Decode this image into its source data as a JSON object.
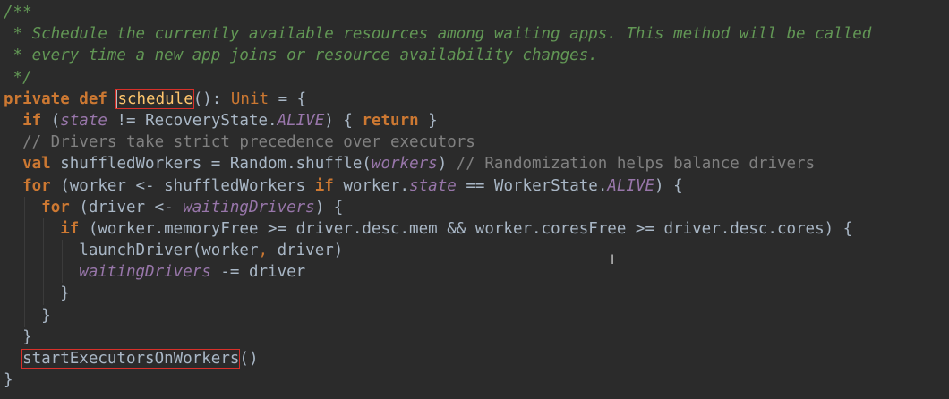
{
  "editor": {
    "lines": [
      {
        "segments": [
          {
            "c": "doc",
            "t": "/**"
          }
        ]
      },
      {
        "segments": [
          {
            "c": "doc",
            "t": " * Schedule the currently available resources among waiting apps. This method will be called"
          }
        ]
      },
      {
        "segments": [
          {
            "c": "doc",
            "t": " * every time a new app joins or resource availability changes."
          }
        ]
      },
      {
        "segments": [
          {
            "c": "doc",
            "t": " */"
          }
        ]
      },
      {
        "segments": [
          {
            "c": "kw",
            "t": "private def "
          },
          {
            "c": "fn-decl boxed caret-box",
            "t": "schedule"
          },
          {
            "c": "plain",
            "t": "(): "
          },
          {
            "c": "type",
            "t": "Unit"
          },
          {
            "c": "plain",
            "t": " = {"
          }
        ]
      },
      {
        "indent": 1,
        "segments": [
          {
            "c": "kw",
            "t": "if "
          },
          {
            "c": "plain",
            "t": "("
          },
          {
            "c": "field",
            "t": "state"
          },
          {
            "c": "plain",
            "t": " != RecoveryState."
          },
          {
            "c": "const",
            "t": "ALIVE"
          },
          {
            "c": "plain",
            "t": ") { "
          },
          {
            "c": "kw",
            "t": "return"
          },
          {
            "c": "plain",
            "t": " }"
          }
        ]
      },
      {
        "indent": 1,
        "segments": [
          {
            "c": "comment",
            "t": "// Drivers take strict precedence over executors"
          }
        ]
      },
      {
        "indent": 1,
        "segments": [
          {
            "c": "kw",
            "t": "val "
          },
          {
            "c": "plain",
            "t": "shuffledWorkers = Random.shuffle("
          },
          {
            "c": "field",
            "t": "workers"
          },
          {
            "c": "plain",
            "t": ") "
          },
          {
            "c": "comment",
            "t": "// Randomization helps balance drivers"
          }
        ]
      },
      {
        "indent": 1,
        "segments": [
          {
            "c": "kw",
            "t": "for "
          },
          {
            "c": "plain",
            "t": "(worker <- shuffledWorkers "
          },
          {
            "c": "kw",
            "t": "if "
          },
          {
            "c": "plain",
            "t": "worker."
          },
          {
            "c": "field",
            "t": "state"
          },
          {
            "c": "plain",
            "t": " == WorkerState."
          },
          {
            "c": "const",
            "t": "ALIVE"
          },
          {
            "c": "plain",
            "t": ") {"
          }
        ]
      },
      {
        "indent": 2,
        "segments": [
          {
            "c": "kw",
            "t": "for "
          },
          {
            "c": "plain",
            "t": "(driver <- "
          },
          {
            "c": "field",
            "t": "waitingDrivers"
          },
          {
            "c": "plain",
            "t": ") {"
          }
        ]
      },
      {
        "indent": 3,
        "segments": [
          {
            "c": "kw",
            "t": "if "
          },
          {
            "c": "plain",
            "t": "(worker.memoryFree >= driver.desc.mem && worker.coresFree >= driver.desc.cores) {"
          }
        ]
      },
      {
        "indent": 4,
        "segments": [
          {
            "c": "plain",
            "t": "launchDriver(worker"
          },
          {
            "c": "kw-plain",
            "t": ", "
          },
          {
            "c": "plain",
            "t": "driver)"
          }
        ]
      },
      {
        "indent": 4,
        "segments": [
          {
            "c": "field",
            "t": "waitingDrivers"
          },
          {
            "c": "plain",
            "t": " -= driver"
          }
        ]
      },
      {
        "indent": 3,
        "segments": [
          {
            "c": "plain",
            "t": "}"
          }
        ]
      },
      {
        "indent": 2,
        "segments": [
          {
            "c": "plain",
            "t": "}"
          }
        ]
      },
      {
        "indent": 1,
        "segments": [
          {
            "c": "plain",
            "t": "}"
          }
        ]
      },
      {
        "indent": 1,
        "segments": [
          {
            "c": "plain boxed",
            "t": "startExecutorsOnWorkers"
          },
          {
            "c": "plain",
            "t": "()"
          }
        ]
      },
      {
        "segments": [
          {
            "c": "plain",
            "t": "}"
          }
        ]
      }
    ]
  },
  "colors": {
    "background": "#2b2b2b",
    "keyword": "#cc7832",
    "doc_comment": "#629755",
    "line_comment": "#808080",
    "field": "#9876aa",
    "function_decl": "#ffc66d",
    "plain": "#a9b7c6",
    "highlight_box": "#d9302a"
  },
  "cursor_icon": "text-cursor-icon"
}
